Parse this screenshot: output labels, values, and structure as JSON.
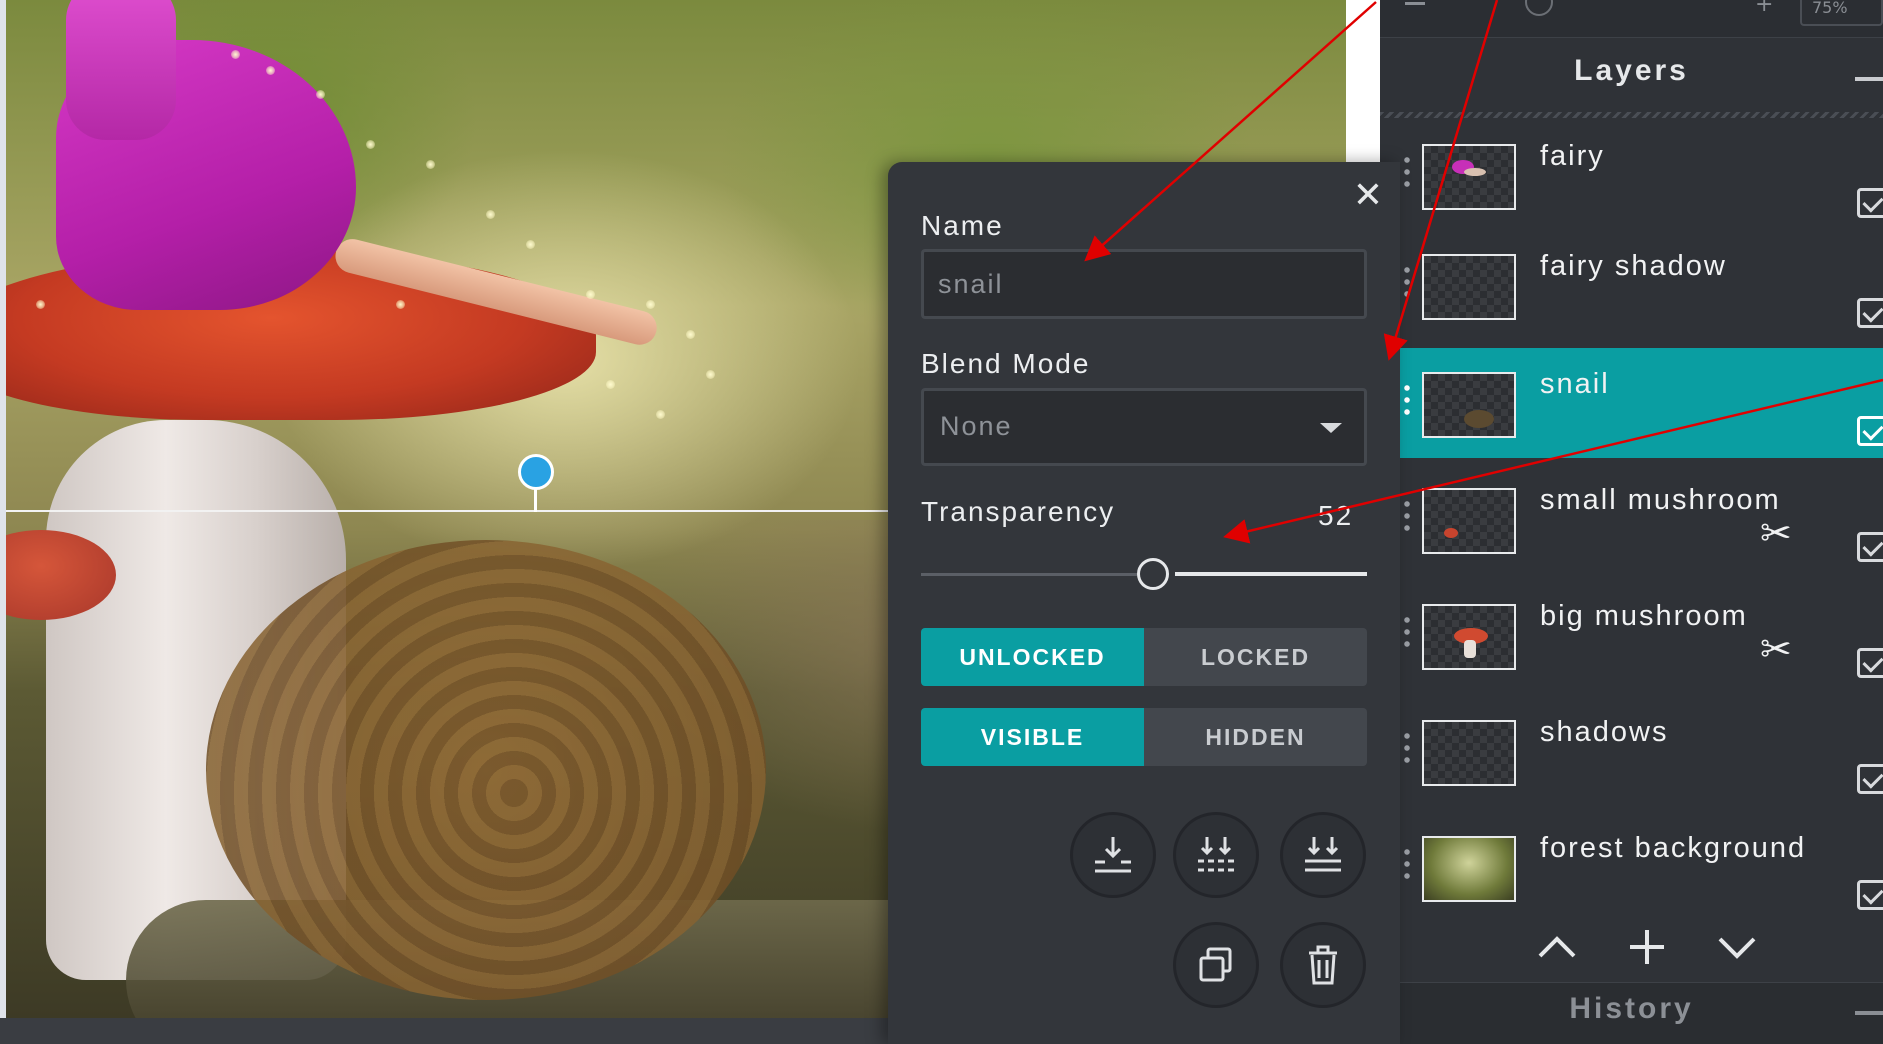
{
  "layers_panel": {
    "title": "Layers",
    "layers": [
      {
        "name": "fairy",
        "visible": true,
        "selected": false,
        "clipped": false
      },
      {
        "name": "fairy shadow",
        "visible": true,
        "selected": false,
        "clipped": false
      },
      {
        "name": "snail",
        "visible": true,
        "selected": true,
        "clipped": false
      },
      {
        "name": "small mushroom",
        "visible": true,
        "selected": false,
        "clipped": true
      },
      {
        "name": "big mushroom",
        "visible": true,
        "selected": false,
        "clipped": true
      },
      {
        "name": "shadows",
        "visible": true,
        "selected": false,
        "clipped": false
      },
      {
        "name": "forest background",
        "visible": true,
        "selected": false,
        "clipped": false
      }
    ],
    "nav": {
      "up": "⌃",
      "add": "+",
      "down": "⌄"
    }
  },
  "history_panel": {
    "title": "History"
  },
  "topbar": {
    "zoom_fragment": "75%"
  },
  "layer_properties": {
    "close_glyph": "✕",
    "name_label": "Name",
    "name_value": "snail",
    "blend_label": "Blend Mode",
    "blend_value": "None",
    "transparency_label": "Transparency",
    "transparency_value": 52,
    "transparency_value_text": "52",
    "lock_options": [
      {
        "label": "UNLOCKED",
        "active": true
      },
      {
        "label": "LOCKED",
        "active": false
      }
    ],
    "visibility_options": [
      {
        "label": "VISIBLE",
        "active": true
      },
      {
        "label": "HIDDEN",
        "active": false
      }
    ],
    "action_icons": [
      "merge-down-icon",
      "merge-visible-icon",
      "flatten-icon",
      "duplicate-icon",
      "delete-icon"
    ]
  },
  "colors": {
    "accent": "#0a9ea2",
    "panel_bg": "#2f3237",
    "popup_bg": "#33363b",
    "annotation": "#e00000"
  }
}
